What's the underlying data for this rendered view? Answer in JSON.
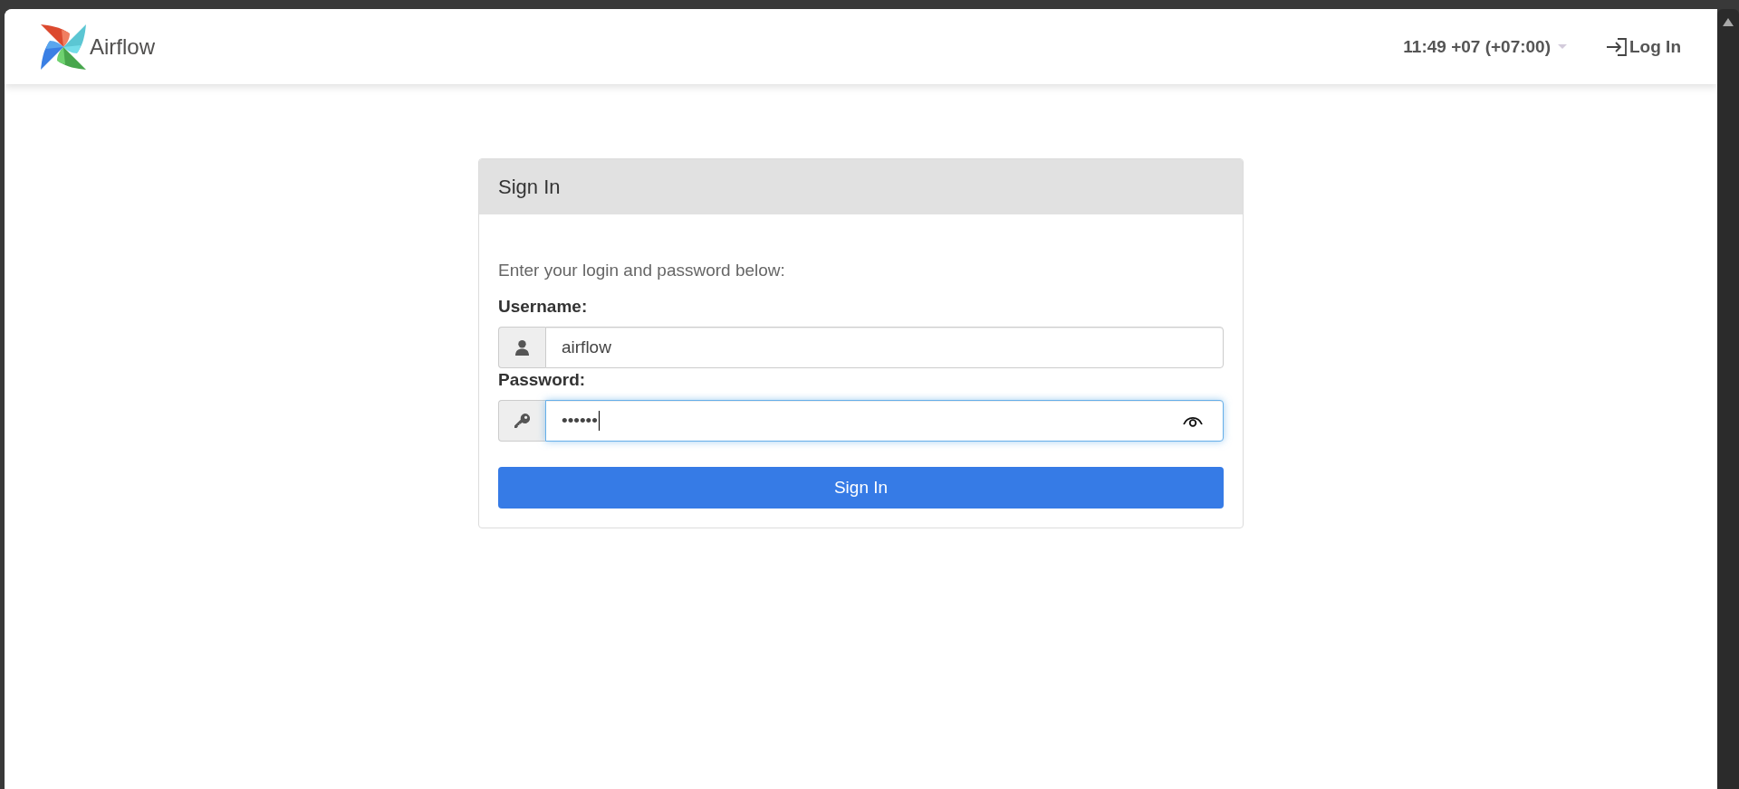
{
  "header": {
    "brand": "Airflow",
    "clock": "11:49 +07 (+07:00)",
    "login_link": "Log In"
  },
  "login_card": {
    "title": "Sign In",
    "intro": "Enter your login and password below:",
    "fields": [
      {
        "kind": "username",
        "label": "Username:",
        "value": "airflow",
        "focused": false
      },
      {
        "kind": "password",
        "label": "Password:",
        "value": "••••••",
        "focused": true
      }
    ],
    "submit_button": "Sign In"
  }
}
